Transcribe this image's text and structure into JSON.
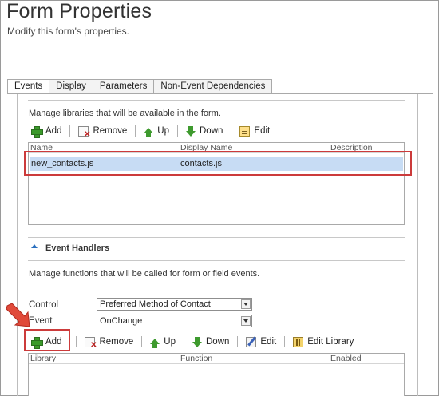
{
  "header": {
    "title": "Form Properties",
    "subtitle": "Modify this form's properties."
  },
  "tabs": [
    {
      "label": "Events",
      "selected": true
    },
    {
      "label": "Display"
    },
    {
      "label": "Parameters"
    },
    {
      "label": "Non-Event Dependencies"
    }
  ],
  "libraries": {
    "description": "Manage libraries that will be available in the form.",
    "toolbar": {
      "add": "Add",
      "remove": "Remove",
      "up": "Up",
      "down": "Down",
      "edit": "Edit"
    },
    "columns": {
      "name": "Name",
      "display_name": "Display Name",
      "description": "Description"
    },
    "rows": [
      {
        "name": "new_contacts.js",
        "display_name": "contacts.js",
        "description": ""
      }
    ]
  },
  "event_handlers": {
    "title": "Event Handlers",
    "description": "Manage functions that will be called for form or field events.",
    "control_label": "Control",
    "control_value": "Preferred Method of Contact",
    "event_label": "Event",
    "event_value": "OnChange",
    "toolbar": {
      "add": "Add",
      "remove": "Remove",
      "up": "Up",
      "down": "Down",
      "edit": "Edit",
      "edit_library": "Edit Library"
    },
    "columns": {
      "library": "Library",
      "function": "Function",
      "enabled": "Enabled"
    }
  },
  "colors": {
    "annotation_red": "#cc3b3b",
    "selected_row": "#c7dcf4"
  }
}
